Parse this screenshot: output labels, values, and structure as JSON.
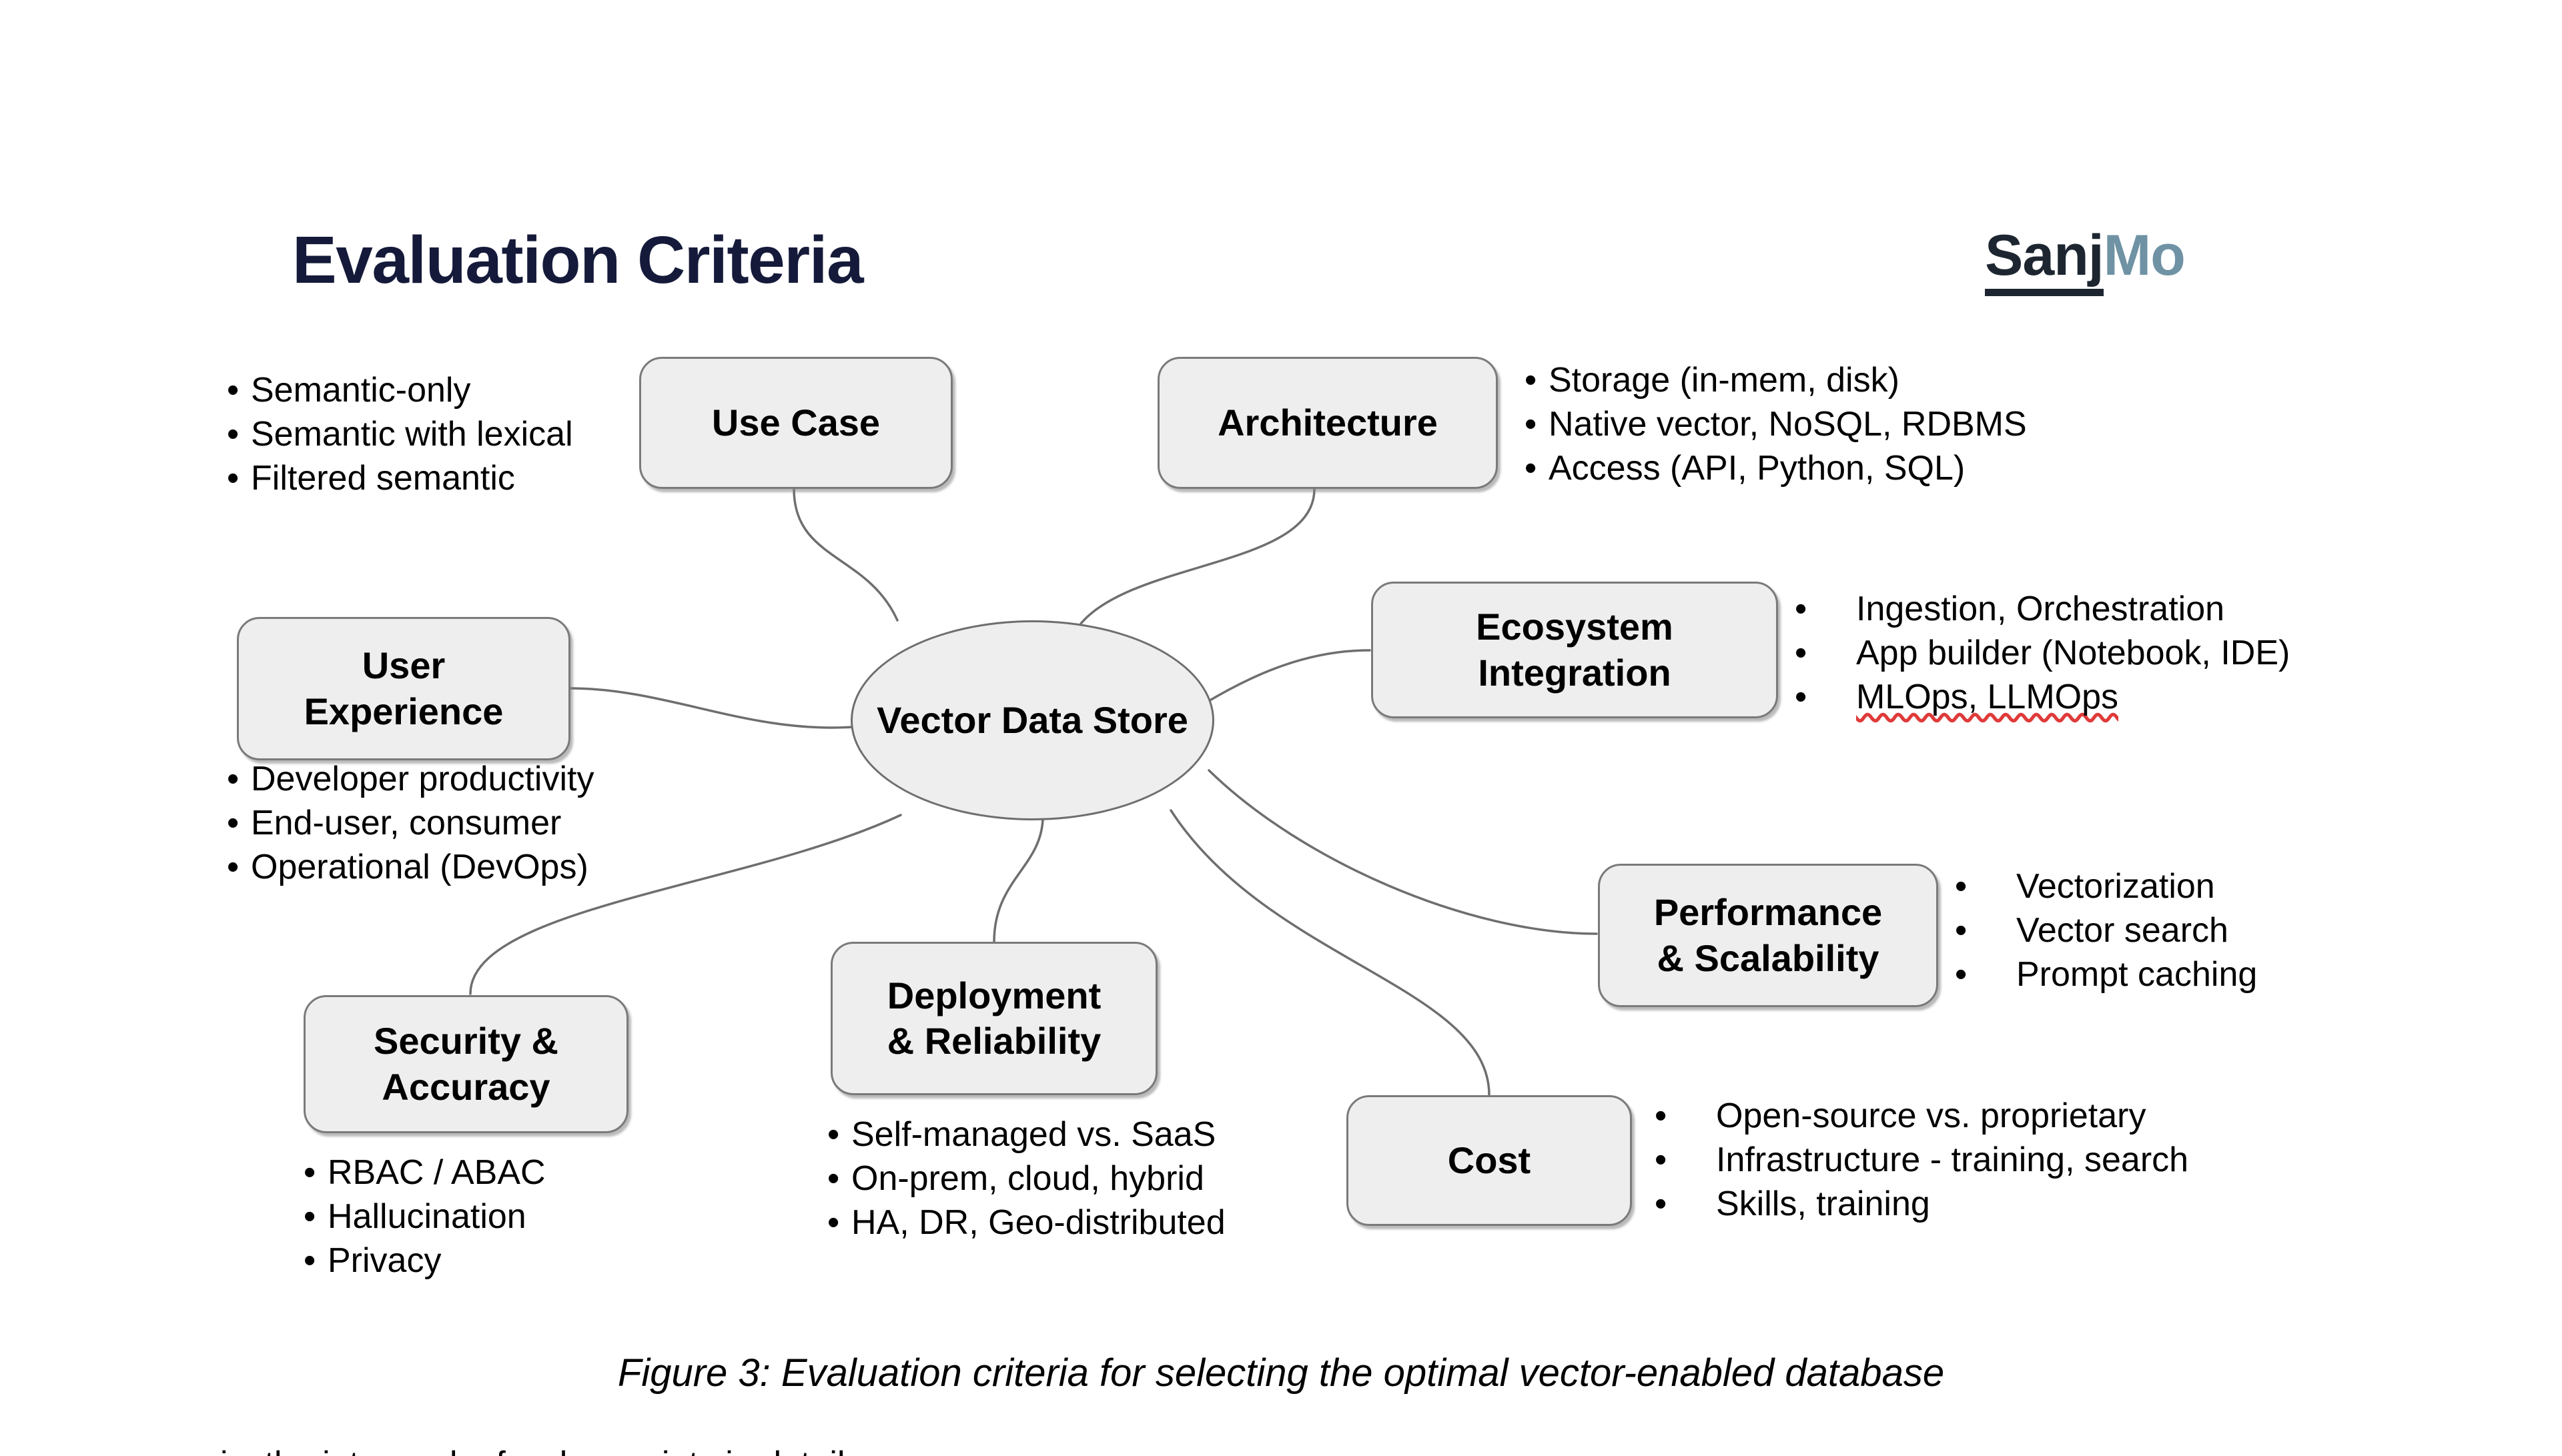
{
  "header": {
    "title": "Evaluation Criteria",
    "logo_primary": "Sanj",
    "logo_accent": "Mo",
    "title_color": "#151a3a",
    "logo_primary_color": "#1d2630",
    "logo_accent_color": "#6f92a4"
  },
  "center": {
    "line1": "Vector",
    "line2": "Data Store"
  },
  "nodes": {
    "use_case": {
      "line1": "Use Case"
    },
    "architecture": {
      "line1": "Architecture"
    },
    "ecosystem": {
      "line1": "Ecosystem",
      "line2": "Integration"
    },
    "performance": {
      "line1": "Performance",
      "line2": "& Scalability"
    },
    "cost": {
      "line1": "Cost"
    },
    "deployment": {
      "line1": "Deployment",
      "line2": "& Reliability"
    },
    "security": {
      "line1": "Security &",
      "line2": "Accuracy"
    },
    "user_experience": {
      "line1": "User",
      "line2": "Experience"
    }
  },
  "lists": {
    "use_case": [
      "Semantic-only",
      "Semantic with lexical",
      "Filtered semantic"
    ],
    "architecture": [
      "Storage (in-mem, disk)",
      "Native vector, NoSQL, RDBMS",
      "Access (API, Python, SQL)"
    ],
    "ecosystem": [
      "Ingestion, Orchestration",
      "App builder (Notebook, IDE)",
      "MLOps, LLMOps"
    ],
    "performance": [
      "Vectorization",
      "Vector search",
      "Prompt caching"
    ],
    "cost": [
      "Open-source vs. proprietary",
      "Infrastructure - training, search",
      "Skills, training"
    ],
    "deployment": [
      "Self-managed vs. SaaS",
      "On-prem, cloud, hybrid",
      "HA, DR, Geo-distributed"
    ],
    "security": [
      "RBAC / ABAC",
      "Hallucination",
      "Privacy"
    ],
    "user_experience": [
      "Developer productivity",
      "End-user, consumer",
      "Operational (DevOps)"
    ]
  },
  "ecosystem_spellcheck_word": "LLMOps",
  "caption": "Figure 3: Evaluation criteria for selecting the optimal vector-enabled database",
  "cut_off_line": "is, the intro and a few key points in detail.",
  "chart_data": {
    "type": "diagram",
    "diagram_kind": "mind-map",
    "title": "Evaluation Criteria",
    "center_node": "Vector Data Store",
    "branches": [
      {
        "label": "Use Case",
        "items": [
          "Semantic-only",
          "Semantic with lexical",
          "Filtered semantic"
        ]
      },
      {
        "label": "Architecture",
        "items": [
          "Storage (in-mem, disk)",
          "Native vector, NoSQL, RDBMS",
          "Access (API, Python, SQL)"
        ]
      },
      {
        "label": "Ecosystem Integration",
        "items": [
          "Ingestion, Orchestration",
          "App builder (Notebook, IDE)",
          "MLOps, LLMOps"
        ]
      },
      {
        "label": "Performance & Scalability",
        "items": [
          "Vectorization",
          "Vector search",
          "Prompt caching"
        ]
      },
      {
        "label": "Cost",
        "items": [
          "Open-source vs. proprietary",
          "Infrastructure - training, search",
          "Skills, training"
        ]
      },
      {
        "label": "Deployment & Reliability",
        "items": [
          "Self-managed vs. SaaS",
          "On-prem, cloud, hybrid",
          "HA, DR, Geo-distributed"
        ]
      },
      {
        "label": "Security & Accuracy",
        "items": [
          "RBAC / ABAC",
          "Hallucination",
          "Privacy"
        ]
      },
      {
        "label": "User Experience",
        "items": [
          "Developer productivity",
          "End-user, consumer",
          "Operational (DevOps)"
        ]
      }
    ],
    "node_fill": "#eeeeee",
    "node_stroke": "#7a7a7a",
    "edge_stroke": "#6e6e6e"
  }
}
